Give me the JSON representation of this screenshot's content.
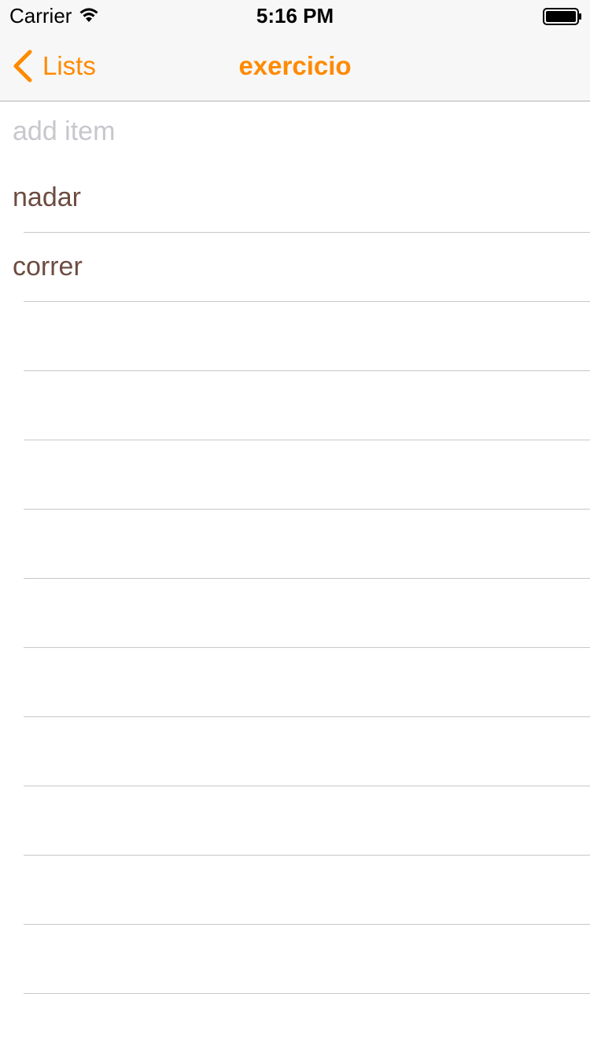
{
  "status_bar": {
    "carrier": "Carrier",
    "time": "5:16 PM",
    "wifi_icon": "wifi-icon",
    "battery_icon": "battery-icon"
  },
  "nav": {
    "back_label": "Lists",
    "back_icon": "chevron-left-icon",
    "title": "exercicio"
  },
  "input": {
    "placeholder": "add item",
    "value": ""
  },
  "items": [
    {
      "label": "nadar"
    },
    {
      "label": "correr"
    }
  ],
  "colors": {
    "accent": "#ff8a00",
    "item_text": "#6d4c41",
    "placeholder": "#c7c7cd",
    "separator": "#c8c7cc"
  }
}
